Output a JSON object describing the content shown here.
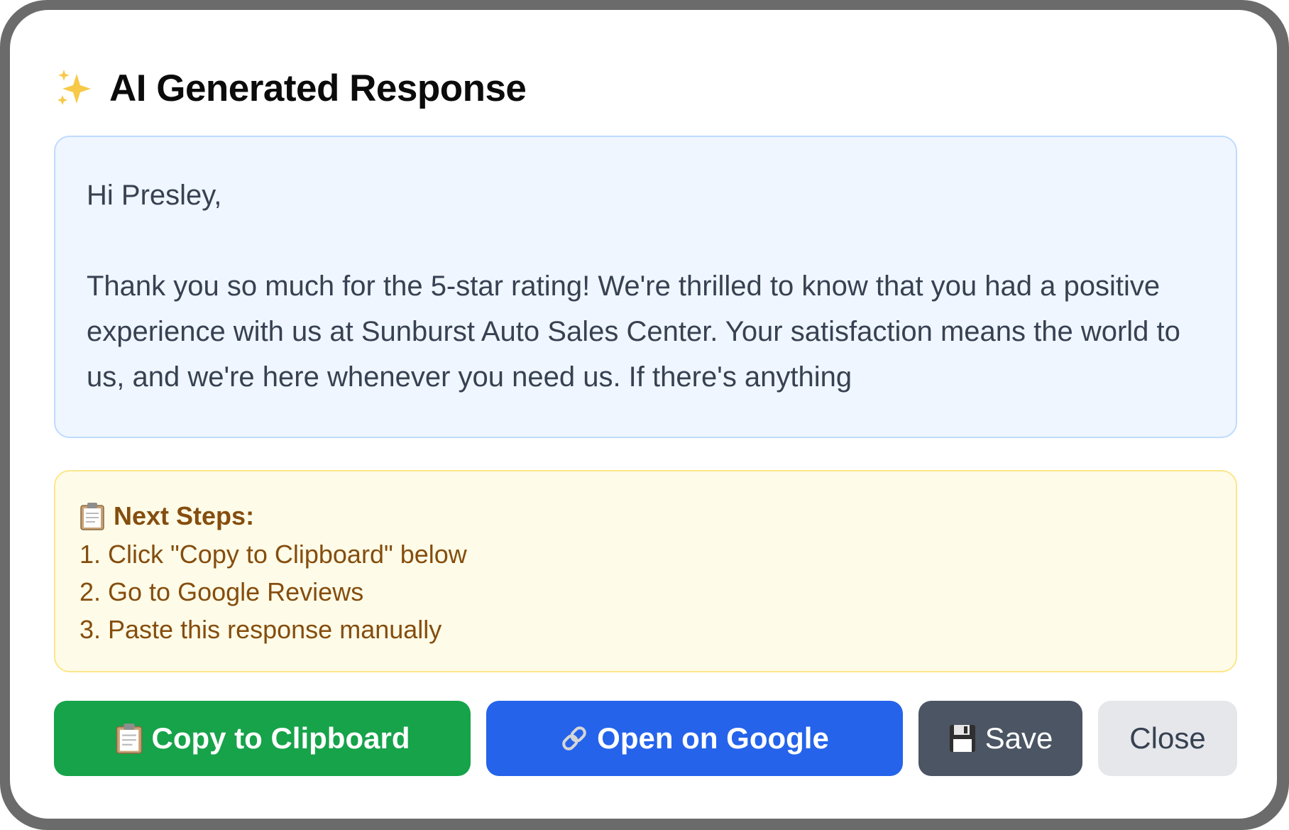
{
  "dialog": {
    "title": "AI Generated Response",
    "icon": "sparkles-icon"
  },
  "response": {
    "greeting": "Hi Presley,",
    "body": "Thank you so much for the 5-star rating! We're thrilled to know that you had a positive experience with us at Sunburst Auto Sales Center. Your satisfaction means the world to us, and we're here whenever you need us. If there's anything"
  },
  "next_steps": {
    "title": "Next Steps:",
    "icon": "clipboard-icon",
    "steps": [
      "1. Click \"Copy to Clipboard\" below",
      "2. Go to Google Reviews",
      "3. Paste this response manually"
    ]
  },
  "buttons": {
    "copy": {
      "label": "Copy to Clipboard",
      "icon": "clipboard-icon",
      "color": "#16a34a"
    },
    "google": {
      "label": "Open on Google",
      "icon": "link-icon",
      "color": "#2563eb"
    },
    "save": {
      "label": "Save",
      "icon": "floppy-disk-icon",
      "color": "#4b5563"
    },
    "close": {
      "label": "Close",
      "color": "#e5e7eb"
    }
  },
  "colors": {
    "response_bg": "#eff6ff",
    "response_border": "#bfdbfe",
    "steps_bg": "#fefce8",
    "steps_border": "#fde68a",
    "steps_text": "#854d0e"
  }
}
